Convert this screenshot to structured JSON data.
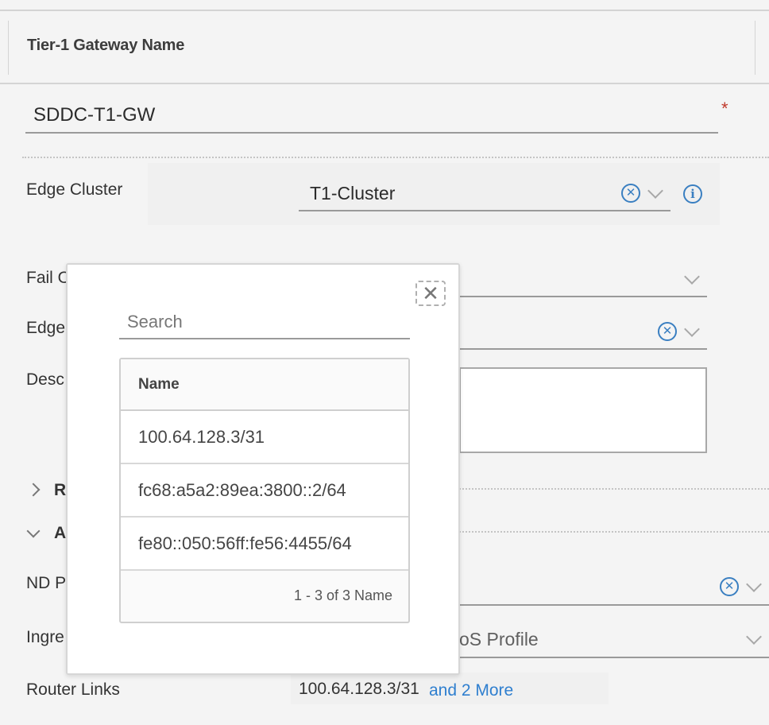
{
  "header": {
    "column_title": "Tier-1 Gateway Name"
  },
  "form": {
    "gateway_name_value": "SDDC-T1-GW",
    "required_marker": "*",
    "labels": {
      "edge_cluster": "Edge Cluster",
      "fail_over": "Fail O",
      "edges": "Edge",
      "description": "Desc",
      "route_section": "R",
      "additional_section": "A",
      "nd_profile": "ND P",
      "ingress": "Ingre",
      "router_links": "Router Links"
    },
    "edge_cluster_value": "T1-Cluster",
    "ingress_value": "oS Profile",
    "router_links_value": "100.64.128.3/31",
    "router_links_more": "and 2 More"
  },
  "icons": {
    "clear": "clear-circle-x-icon",
    "dropdown": "chevron-down-icon",
    "info": "info-icon",
    "close": "close-icon",
    "expand": "chevron-right-icon"
  },
  "popover": {
    "close_glyph": "✕",
    "search_placeholder": "Search",
    "grid": {
      "column_header": "Name",
      "rows": [
        "100.64.128.3/31",
        "fc68:a5a2:89ea:3800::2/64",
        "fe80::050:56ff:fe56:4455/64"
      ],
      "footer": "1 - 3 of 3 Name"
    }
  },
  "colors": {
    "accent": "#3a7fc1",
    "link": "#2f7fcf",
    "required": "#c0392b",
    "background": "#f4f4f4"
  }
}
